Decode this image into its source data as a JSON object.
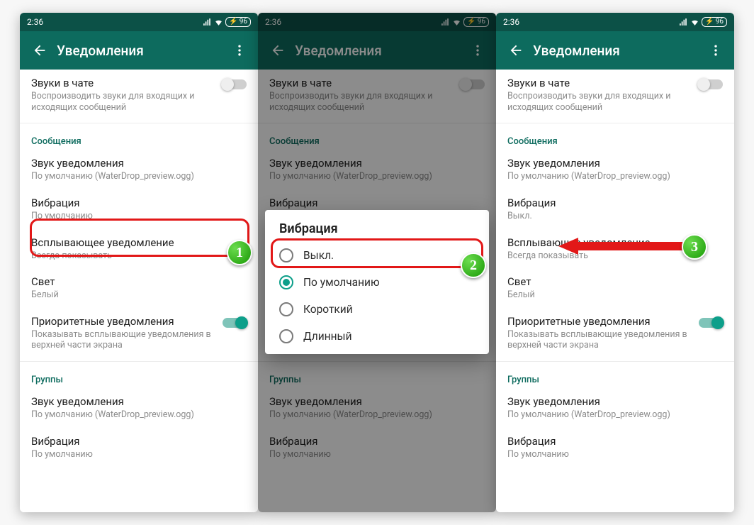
{
  "status": {
    "time": "2:36",
    "battery": "96"
  },
  "appbar": {
    "title": "Уведомления"
  },
  "chat_sounds": {
    "title": "Звуки в чате",
    "subtitle": "Воспроизводить звуки для входящих и исходящих сообщений"
  },
  "sections": {
    "messages": "Сообщения",
    "groups": "Группы"
  },
  "notif_sound": {
    "title": "Звук уведомления",
    "subtitle": "По умолчанию (WaterDrop_preview.ogg)"
  },
  "vibration": {
    "title": "Вибрация",
    "default": "По умолчанию",
    "off": "Выкл."
  },
  "popup": {
    "title": "Всплывающее уведомление",
    "subtitle": "Всегда показывать"
  },
  "light": {
    "title": "Свет",
    "subtitle": "Белый"
  },
  "priority": {
    "title": "Приоритетные уведомления",
    "subtitle": "Показывать всплывающие уведомления в верхней части экрана"
  },
  "group_vibration": {
    "title": "Вибрация",
    "subtitle": "По умолчанию"
  },
  "dialog": {
    "title": "Вибрация",
    "options": [
      "Выкл.",
      "По умолчанию",
      "Короткий",
      "Длинный"
    ],
    "selected": "По умолчанию"
  },
  "badges": {
    "1": "1",
    "2": "2",
    "3": "3"
  }
}
